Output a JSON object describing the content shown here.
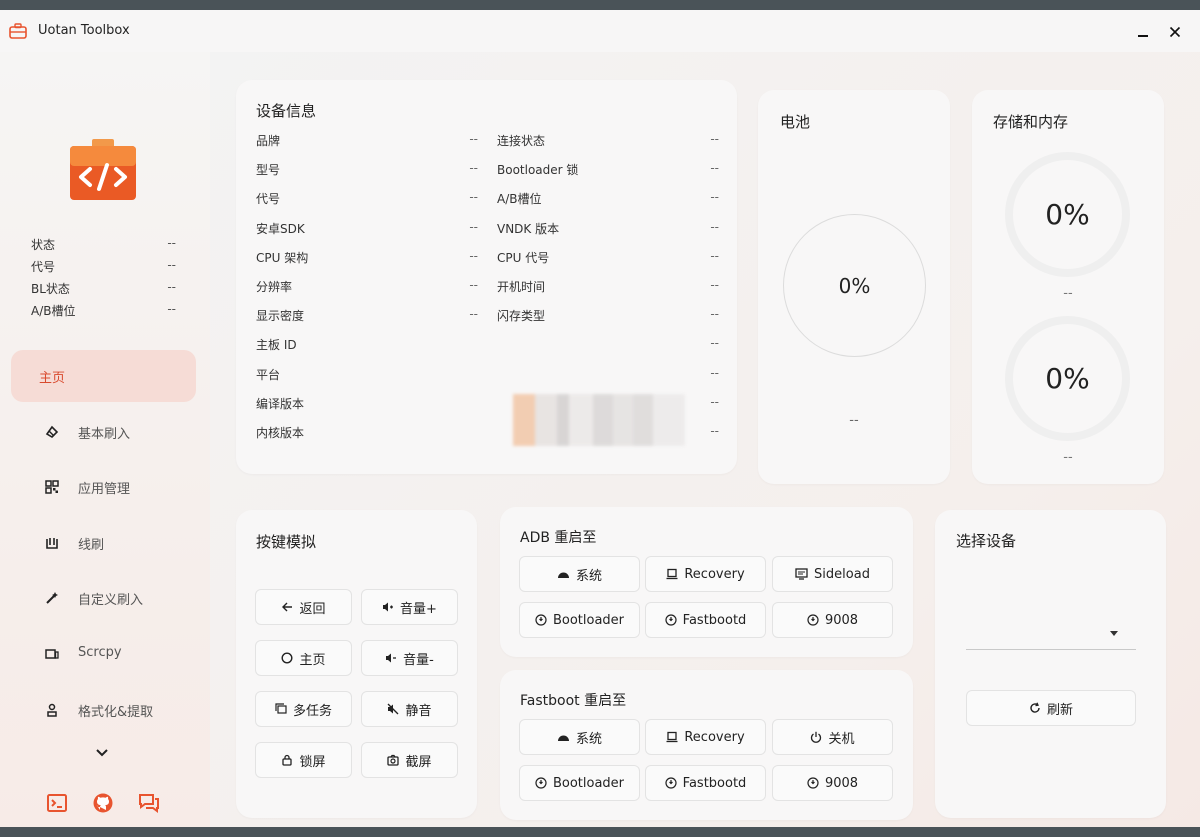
{
  "app": {
    "title": "Uotan Toolbox"
  },
  "colors": {
    "accent": "#e8542f",
    "active_bg": "#f6dcd6"
  },
  "sidebar": {
    "info": [
      {
        "label": "状态",
        "value": "--"
      },
      {
        "label": "代号",
        "value": "--"
      },
      {
        "label": "BL状态",
        "value": "--"
      },
      {
        "label": "A/B槽位",
        "value": "--"
      }
    ],
    "nav": [
      {
        "label": "主页",
        "icon": "home-icon",
        "active": true
      },
      {
        "label": "基本刷入",
        "icon": "flash-icon"
      },
      {
        "label": "应用管理",
        "icon": "apps-icon"
      },
      {
        "label": "线刷",
        "icon": "wired-flash-icon"
      },
      {
        "label": "自定义刷入",
        "icon": "custom-flash-icon"
      },
      {
        "label": "Scrcpy",
        "icon": "screen-icon"
      },
      {
        "label": "格式化&提取",
        "icon": "format-icon"
      }
    ]
  },
  "device_info": {
    "title": "设备信息",
    "left": [
      {
        "label": "品牌",
        "value": "--"
      },
      {
        "label": "型号",
        "value": "--"
      },
      {
        "label": "代号",
        "value": "--"
      },
      {
        "label": "安卓SDK",
        "value": "--"
      },
      {
        "label": "CPU 架构",
        "value": "--"
      },
      {
        "label": "分辨率",
        "value": "--"
      },
      {
        "label": "显示密度",
        "value": "--"
      },
      {
        "label": "主板 ID",
        "value": ""
      },
      {
        "label": "平台",
        "value": ""
      },
      {
        "label": "编译版本",
        "value": ""
      },
      {
        "label": "内核版本",
        "value": ""
      }
    ],
    "right": [
      {
        "label": "连接状态",
        "value": "--"
      },
      {
        "label": "Bootloader 锁",
        "value": "--"
      },
      {
        "label": "A/B槽位",
        "value": "--"
      },
      {
        "label": "VNDK 版本",
        "value": "--"
      },
      {
        "label": "CPU 代号",
        "value": "--"
      },
      {
        "label": "开机时间",
        "value": "--"
      },
      {
        "label": "闪存类型",
        "value": "--"
      },
      {
        "label": "",
        "value": "--"
      },
      {
        "label": "",
        "value": "--"
      },
      {
        "label": "",
        "value": "--"
      },
      {
        "label": "",
        "value": "--"
      }
    ]
  },
  "battery": {
    "title": "电池",
    "percent": "0%",
    "detail": "--"
  },
  "storage": {
    "title": "存储和内存",
    "storage_percent": "0%",
    "storage_detail": "--",
    "memory_percent": "0%",
    "memory_detail": "--"
  },
  "key_sim": {
    "title": "按键模拟",
    "back": "返回",
    "vol_up": "音量+",
    "home": "主页",
    "vol_down": "音量-",
    "multitask": "多任务",
    "mute": "静音",
    "lock": "锁屏",
    "screenshot": "截屏"
  },
  "adb_reboot": {
    "title": "ADB 重启至",
    "system": "系统",
    "recovery": "Recovery",
    "sideload": "Sideload",
    "bootloader": "Bootloader",
    "fastbootd": "Fastbootd",
    "edl": "9008"
  },
  "fastboot_reboot": {
    "title": "Fastboot 重启至",
    "system": "系统",
    "recovery": "Recovery",
    "poweroff": "关机",
    "bootloader": "Bootloader",
    "fastbootd": "Fastbootd",
    "edl": "9008"
  },
  "select_device": {
    "title": "选择设备",
    "selected": "",
    "refresh": "刷新"
  }
}
